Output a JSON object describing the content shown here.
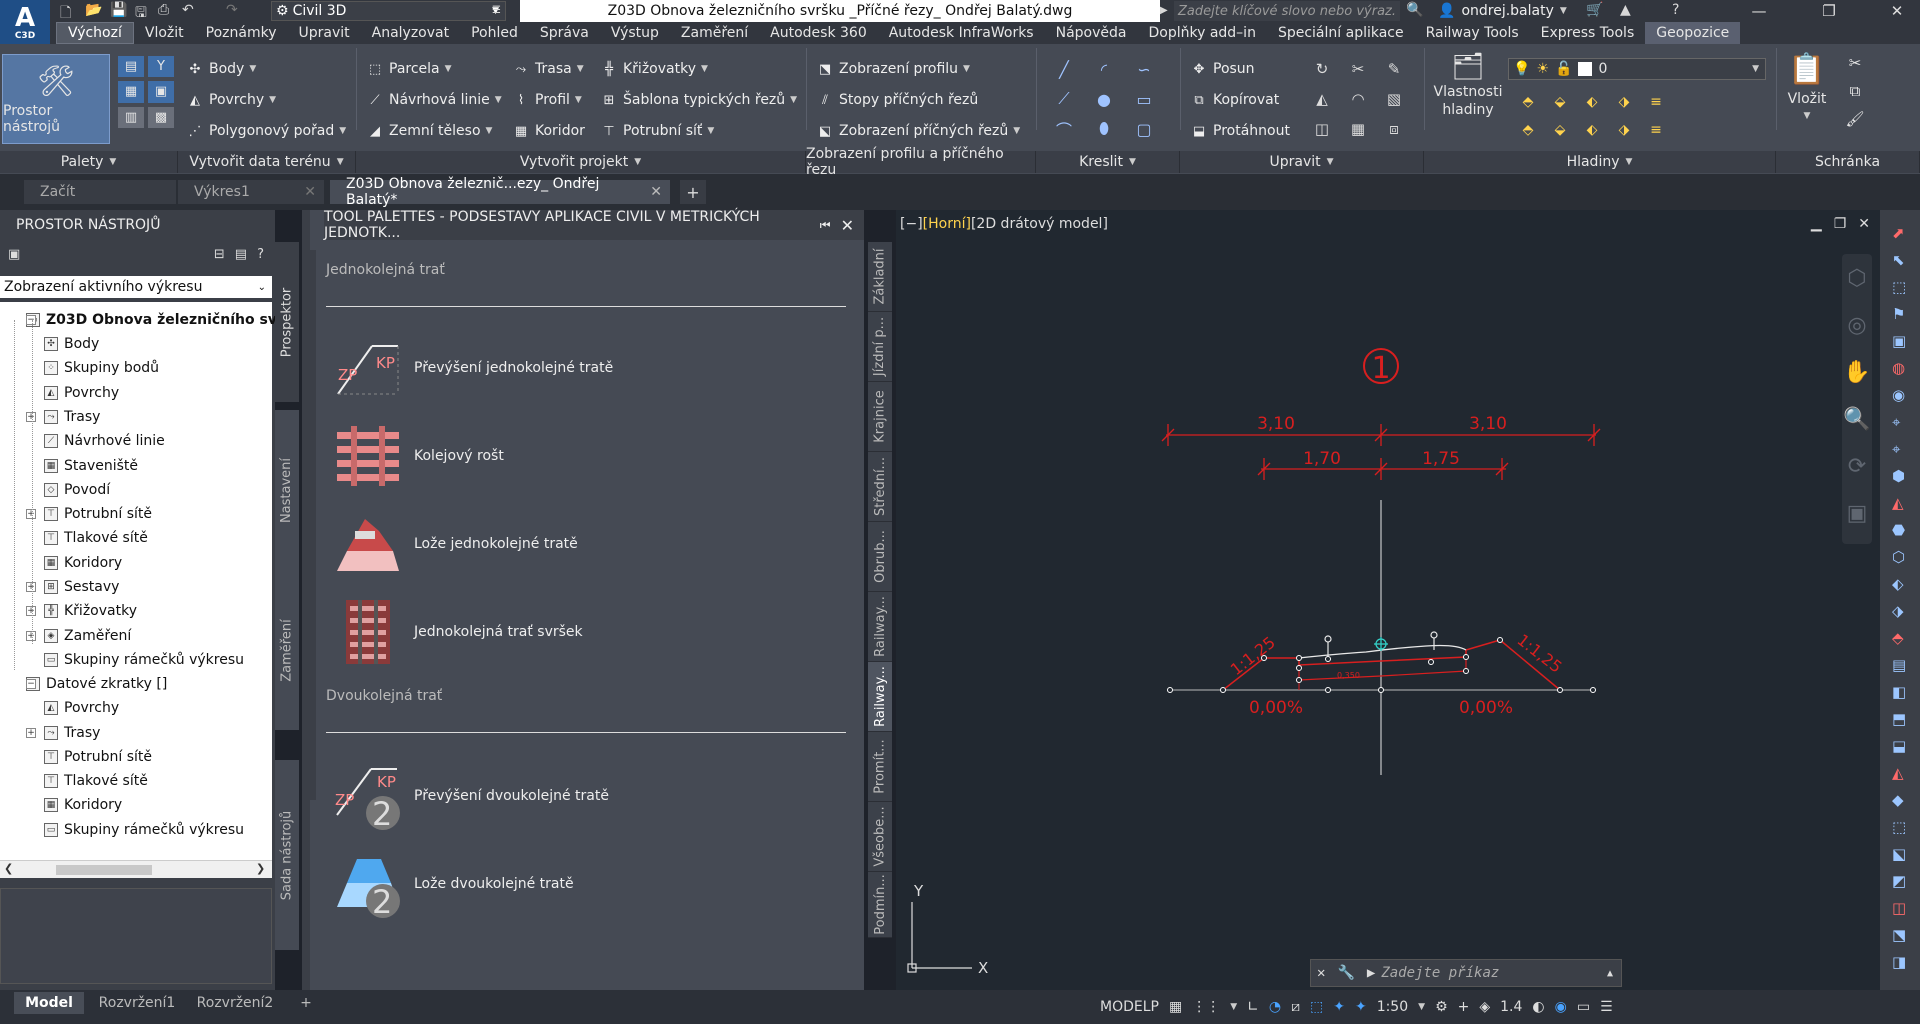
{
  "title_bar": {
    "app_letter": "A",
    "app_name": "C3D",
    "workspace": "Civil 3D",
    "document_title": "Z03D Obnova železničního svršku _Příčné řezy_ Ondřej Balatý.dwg",
    "search_placeholder": "Zadejte klíčové slovo nebo výraz.",
    "user": "ondrej.balaty"
  },
  "menu_tabs": [
    "Výchozí",
    "Vložit",
    "Poznámky",
    "Upravit",
    "Analyzovat",
    "Pohled",
    "Správa",
    "Výstup",
    "Zaměření",
    "Autodesk 360",
    "Autodesk InfraWorks",
    "Nápověda",
    "Doplňky add–in",
    "Speciální aplikace",
    "Railway Tools",
    "Express Tools",
    "Geopozice"
  ],
  "ribbon": {
    "prostor_button": "Prostor nástrojů",
    "body": "Body",
    "povrchy": "Povrchy",
    "polygonovy": "Polygonový pořad",
    "parcela": "Parcela",
    "navrhove_linie": "Návrhová linie",
    "zemni_teleso": "Zemní těleso",
    "trasa": "Trasa",
    "profil": "Profil",
    "koridor": "Koridor",
    "krizovatky": "Křižovatky",
    "sablona": "Šablona typických řezů",
    "potrubni": "Potrubní síť",
    "zobrazeni_profilu": "Zobrazení profilu",
    "stopy": "Stopy příčných řezů",
    "zobrazeni_rezu": "Zobrazení příčných řezů",
    "posun": "Posun",
    "kopirovat": "Kopírovat",
    "protahnout": "Protáhnout",
    "vlastnosti_1": "Vlastnosti",
    "vlastnosti_2": "hladiny",
    "layer_value": "0",
    "vlozit": "Vložit",
    "panels": [
      "Palety",
      "Vytvořit data terénu",
      "Vytvořit projekt",
      "Zobrazení profilu a příčného řezu",
      "Kreslit",
      "Upravit",
      "Hladiny",
      "Schránka"
    ]
  },
  "doc_tabs": [
    "Začít",
    "Výkres1",
    "Z03D Obnova železnič...ezy_ Ondřej Balatý*"
  ],
  "prospector": {
    "title": "PROSTOR NÁSTROJŮ",
    "view_select": "Zobrazení aktivního výkresu",
    "root": "Z03D Obnova železničního svr...",
    "items": [
      "Body",
      "Skupiny bodů",
      "Povrchy",
      "Trasy",
      "Návrhové linie",
      "Staveniště",
      "Povodí",
      "Potrubní sítě",
      "Tlakové sítě",
      "Koridory",
      "Sestavy",
      "Křižovatky",
      "Zaměření",
      "Skupiny rámečků výkresu"
    ],
    "shortcuts_root": "Datové zkratky []",
    "shortcut_items": [
      "Povrchy",
      "Trasy",
      "Potrubní sítě",
      "Tlakové sítě",
      "Koridory",
      "Skupiny rámečků výkresu"
    ],
    "vertical_tabs": [
      "Prospektor",
      "Nastavení",
      "Zaměření",
      "Sada nástrojů"
    ]
  },
  "tool_palette": {
    "title": "TOOL PALETTES - PODSESTAVY APLIKACE CIVIL V METRICKÝCH JEDNOTK...",
    "section1": "Jednokolejná trať",
    "items1": [
      "Převýšení jednokolejné tratě",
      "Kolejový rošt",
      "Lože jednokolejné tratě",
      "Jednokolejná trať svršek"
    ],
    "section2": "Dvoukolejná trať",
    "items2": [
      "Převýšení dvoukolejné tratě",
      "Lože dvoukolejné tratě"
    ],
    "side_tabs": [
      "Základní",
      "Jízdní p...",
      "Krajnice",
      "Střední...",
      "Obrub...",
      "Railway...",
      "Railway...",
      "Promít...",
      "Všeobe...",
      "Podmín..."
    ],
    "zp_label": "ZP",
    "kp_label": "KP",
    "two_label": "2"
  },
  "viewport": {
    "label_minus": "[−]",
    "label_view": "[Horní]",
    "label_style": "[2D drátový model]",
    "section_number": "1",
    "dim_outer_left": "3,10",
    "dim_outer_right": "3,10",
    "dim_inner_left": "1,70",
    "dim_inner_right": "1,75",
    "slope_left": "1:1,25",
    "slope_right": "1:1,25",
    "grade_left": "0,00%",
    "grade_right": "0,00%",
    "small_label": "0,350",
    "ucs_y": "Y",
    "ucs_x": "X"
  },
  "command_line": {
    "placeholder": "Zadejte příkaz"
  },
  "layout_tabs": [
    "Model",
    "Rozvržení1",
    "Rozvržení2"
  ],
  "status": {
    "space": "MODELP",
    "scale": "1:50",
    "annot": "1.4"
  },
  "colors": {
    "accent_red": "#d81f1f",
    "cad_bg": "#212830",
    "ribbon": "#454a54"
  }
}
